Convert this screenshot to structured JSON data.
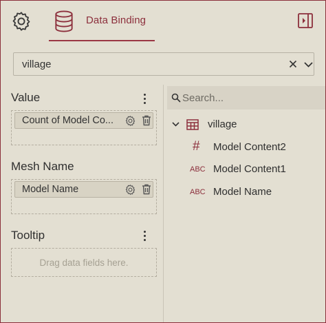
{
  "header": {
    "active_tab_label": "Data Binding",
    "icons": [
      "gear-icon",
      "database-icon",
      "panel-toggle-icon"
    ],
    "accent_color": "#8c2f3c"
  },
  "dataset_select": {
    "value": "village"
  },
  "sections": {
    "value": {
      "title": "Value",
      "chip_label": "Count of Model Co..."
    },
    "mesh_name": {
      "title": "Mesh Name",
      "chip_label": "Model Name"
    },
    "tooltip": {
      "title": "Tooltip",
      "placeholder": "Drag data fields here."
    }
  },
  "field_list": {
    "search_placeholder": "Search...",
    "table_name": "village",
    "fields": [
      {
        "type_label": "#",
        "name": "Model Content2"
      },
      {
        "type_label": "ABC",
        "name": "Model Content1"
      },
      {
        "type_label": "ABC",
        "name": "Model Name"
      }
    ]
  }
}
